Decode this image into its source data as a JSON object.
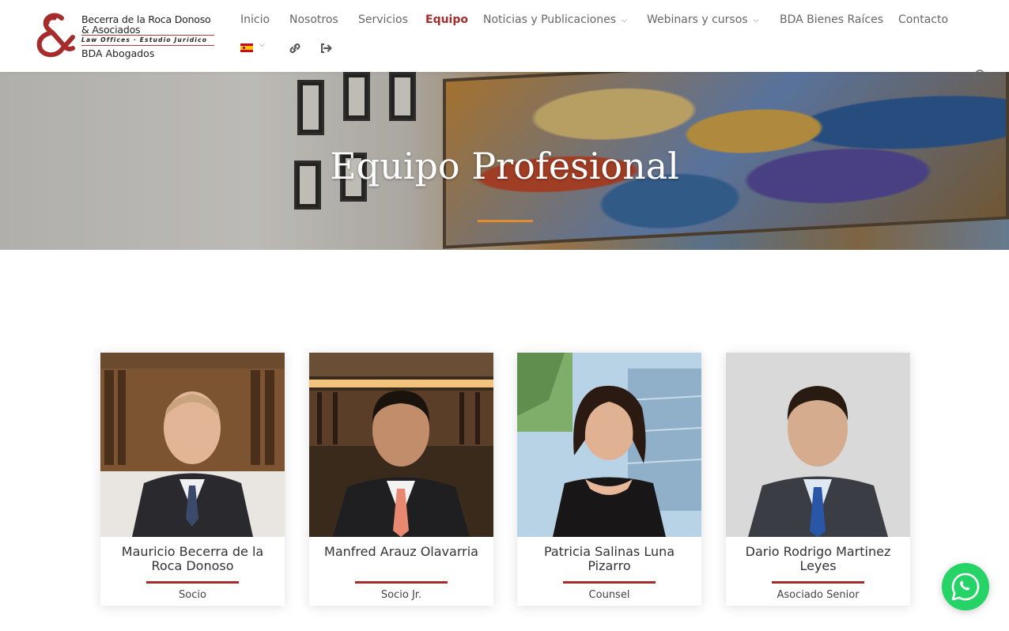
{
  "logo": {
    "line1": "Becerra de la Roca Donoso",
    "line2": "& Asociados",
    "tagline": "Law Offices · Estudio Jurídico",
    "line3": "BDA Abogados"
  },
  "nav": {
    "items": [
      {
        "label": "Inicio",
        "active": false,
        "dropdown": false
      },
      {
        "label": "Nosotros",
        "active": false,
        "dropdown": false
      },
      {
        "label": "Servicios",
        "active": false,
        "dropdown": false
      },
      {
        "label": "Equipo",
        "active": true,
        "dropdown": false
      },
      {
        "label": "Noticias y Publicaciones",
        "active": false,
        "dropdown": true
      },
      {
        "label": "Webinars y cursos",
        "active": false,
        "dropdown": true
      },
      {
        "label": "BDA Bienes Raíces",
        "active": false,
        "dropdown": false
      },
      {
        "label": "Contacto",
        "active": false,
        "dropdown": false
      }
    ],
    "language_icon": "spain-flag-icon",
    "extra_icons": [
      "link-icon",
      "sign-out-icon"
    ]
  },
  "hero": {
    "title": "Equipo Profesional",
    "accent_color": "#e08c2f"
  },
  "team": [
    {
      "name": "Mauricio Becerra de la Roca Donoso",
      "role": "Socio"
    },
    {
      "name": "Manfred Arauz Olavarria",
      "role": "Socio Jr."
    },
    {
      "name": "Patricia Salinas Luna Pizarro",
      "role": "Counsel"
    },
    {
      "name": "Dario Rodrigo Martinez Leyes",
      "role": "Asociado Senior"
    }
  ],
  "colors": {
    "brand": "#a62b2b",
    "nav_text": "#666666",
    "whatsapp": "#25d366"
  },
  "whatsapp": {
    "icon": "whatsapp-icon"
  }
}
